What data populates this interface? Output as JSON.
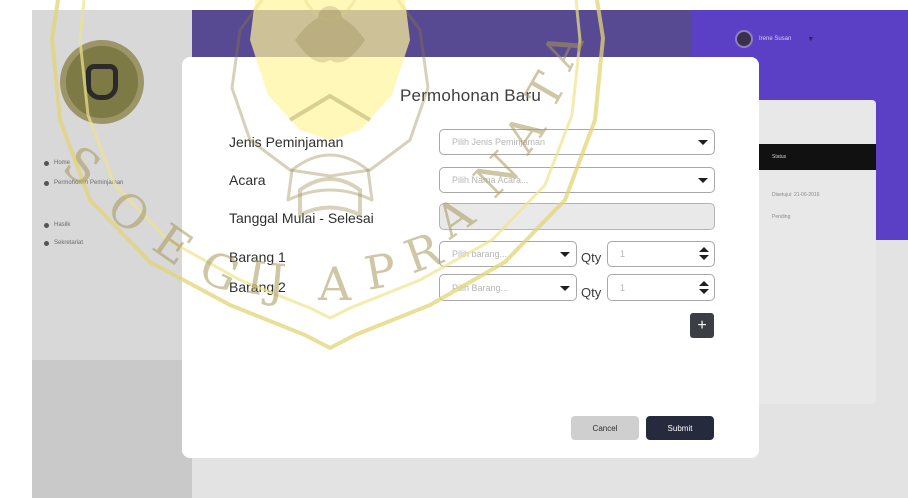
{
  "background": {
    "user_name": "Irene Susan",
    "sidebar_items": [
      "Home",
      "Permohonan Peminjaman",
      "Hasilk",
      "Sekretariat"
    ],
    "panel_header": "Status",
    "panel_rows": [
      "Disetujui: 21-06-2016",
      "Pending"
    ]
  },
  "modal": {
    "title": "Permohonan Baru",
    "labels": {
      "jenis": "Jenis Peminjaman",
      "acara": "Acara",
      "tanggal": "Tanggal Mulai - Selesai",
      "barang1": "Barang 1",
      "barang2": "Barang 2"
    },
    "placeholders": {
      "jenis": "Pilih Jenis Peminjaman",
      "acara": "Pilih Nama Acara...",
      "barang1": "Pilih barang...",
      "barang2": "Pilih Barang...",
      "qty1": "1",
      "qty2": "1"
    },
    "qty_label": "Qty",
    "add_label": "+",
    "cancel_label": "Cancel",
    "submit_label": "Submit"
  },
  "watermark": {
    "text": "SOEGIJAPRANATA",
    "color": "#f4e27a",
    "seal_color": "#fff59a"
  },
  "colors": {
    "topbar": "#584a92",
    "accent_right": "#5b3fc4",
    "submit": "#252a3d",
    "cancel": "#cfcfcf"
  }
}
